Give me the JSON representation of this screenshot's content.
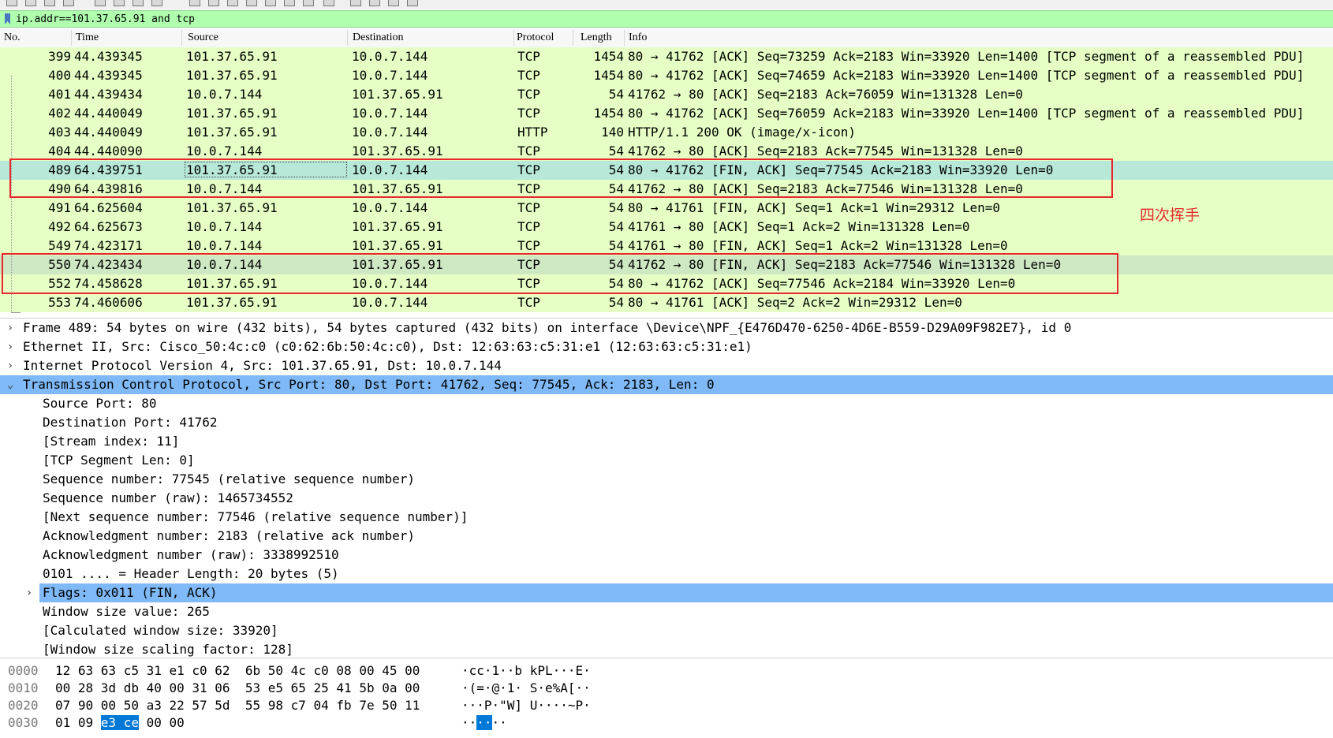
{
  "filter": {
    "value": "ip.addr==101.37.65.91 and tcp"
  },
  "columns": {
    "no": "No.",
    "time": "Time",
    "source": "Source",
    "destination": "Destination",
    "protocol": "Protocol",
    "length": "Length",
    "info": "Info"
  },
  "packets": [
    {
      "no": "399",
      "time": "44.439345",
      "src": "101.37.65.91",
      "dst": "10.0.7.144",
      "proto": "TCP",
      "len": "1454",
      "info": "80 → 41762 [ACK] Seq=73259 Ack=2183 Win=33920 Len=1400 [TCP segment of a reassembled PDU]"
    },
    {
      "no": "400",
      "time": "44.439345",
      "src": "101.37.65.91",
      "dst": "10.0.7.144",
      "proto": "TCP",
      "len": "1454",
      "info": "80 → 41762 [ACK] Seq=74659 Ack=2183 Win=33920 Len=1400 [TCP segment of a reassembled PDU]"
    },
    {
      "no": "401",
      "time": "44.439434",
      "src": "10.0.7.144",
      "dst": "101.37.65.91",
      "proto": "TCP",
      "len": "54",
      "info": "41762 → 80 [ACK] Seq=2183 Ack=76059 Win=131328 Len=0"
    },
    {
      "no": "402",
      "time": "44.440049",
      "src": "101.37.65.91",
      "dst": "10.0.7.144",
      "proto": "TCP",
      "len": "1454",
      "info": "80 → 41762 [ACK] Seq=76059 Ack=2183 Win=33920 Len=1400 [TCP segment of a reassembled PDU]"
    },
    {
      "no": "403",
      "time": "44.440049",
      "src": "101.37.65.91",
      "dst": "10.0.7.144",
      "proto": "HTTP",
      "len": "140",
      "info": "HTTP/1.1 200 OK  (image/x-icon)"
    },
    {
      "no": "404",
      "time": "44.440090",
      "src": "10.0.7.144",
      "dst": "101.37.65.91",
      "proto": "TCP",
      "len": "54",
      "info": "41762 → 80 [ACK] Seq=2183 Ack=77545 Win=131328 Len=0"
    },
    {
      "no": "489",
      "time": "64.439751",
      "src": "101.37.65.91",
      "dst": "10.0.7.144",
      "proto": "TCP",
      "len": "54",
      "info": "80 → 41762 [FIN, ACK] Seq=77545 Ack=2183 Win=33920 Len=0"
    },
    {
      "no": "490",
      "time": "64.439816",
      "src": "10.0.7.144",
      "dst": "101.37.65.91",
      "proto": "TCP",
      "len": "54",
      "info": "41762 → 80 [ACK] Seq=2183 Ack=77546 Win=131328 Len=0"
    },
    {
      "no": "491",
      "time": "64.625604",
      "src": "101.37.65.91",
      "dst": "10.0.7.144",
      "proto": "TCP",
      "len": "54",
      "info": "80 → 41761 [FIN, ACK] Seq=1 Ack=1 Win=29312 Len=0"
    },
    {
      "no": "492",
      "time": "64.625673",
      "src": "10.0.7.144",
      "dst": "101.37.65.91",
      "proto": "TCP",
      "len": "54",
      "info": "41761 → 80 [ACK] Seq=1 Ack=2 Win=131328 Len=0"
    },
    {
      "no": "549",
      "time": "74.423171",
      "src": "10.0.7.144",
      "dst": "101.37.65.91",
      "proto": "TCP",
      "len": "54",
      "info": "41761 → 80 [FIN, ACK] Seq=1 Ack=2 Win=131328 Len=0"
    },
    {
      "no": "550",
      "time": "74.423434",
      "src": "10.0.7.144",
      "dst": "101.37.65.91",
      "proto": "TCP",
      "len": "54",
      "info": "41762 → 80 [FIN, ACK] Seq=2183 Ack=77546 Win=131328 Len=0"
    },
    {
      "no": "552",
      "time": "74.458628",
      "src": "101.37.65.91",
      "dst": "10.0.7.144",
      "proto": "TCP",
      "len": "54",
      "info": "80 → 41762 [ACK] Seq=77546 Ack=2184 Win=33920 Len=0"
    },
    {
      "no": "553",
      "time": "74.460606",
      "src": "101.37.65.91",
      "dst": "10.0.7.144",
      "proto": "TCP",
      "len": "54",
      "info": "80 → 41761 [ACK] Seq=2 Ack=2 Win=29312 Len=0"
    }
  ],
  "annotation": {
    "text": "四次挥手"
  },
  "details": [
    "Frame 489: 54 bytes on wire (432 bits), 54 bytes captured (432 bits) on interface \\Device\\NPF_{E476D470-6250-4D6E-B559-D29A09F982E7}, id 0",
    "Ethernet II, Src: Cisco_50:4c:c0 (c0:62:6b:50:4c:c0), Dst: 12:63:63:c5:31:e1 (12:63:63:c5:31:e1)",
    "Internet Protocol Version 4, Src: 101.37.65.91, Dst: 10.0.7.144",
    "Transmission Control Protocol, Src Port: 80, Dst Port: 41762, Seq: 77545, Ack: 2183, Len: 0",
    "Source Port: 80",
    "Destination Port: 41762",
    "[Stream index: 11]",
    "[TCP Segment Len: 0]",
    "Sequence number: 77545    (relative sequence number)",
    "Sequence number (raw): 1465734552",
    "[Next sequence number: 77546    (relative sequence number)]",
    "Acknowledgment number: 2183    (relative ack number)",
    "Acknowledgment number (raw): 3338992510",
    "0101 .... = Header Length: 20 bytes (5)",
    "Flags: 0x011 (FIN, ACK)",
    "Window size value: 265",
    "[Calculated window size: 33920]",
    "[Window size scaling factor: 128]"
  ],
  "bytes": [
    {
      "offset": "0000",
      "hex": "12 63 63 c5 31 e1 c0 62  6b 50 4c c0 08 00 45 00",
      "ascii": "·cc·1··b kPL···E·"
    },
    {
      "offset": "0010",
      "hex": "00 28 3d db 40 00 31 06  53 e5 65 25 41 5b 0a 00",
      "ascii": "·(=·@·1· S·e%A[··"
    },
    {
      "offset": "0020",
      "hex": "07 90 00 50 a3 22 57 5d  55 98 c7 04 fb 7e 50 11",
      "ascii": "···P·\"W] U····~P·"
    },
    {
      "offset": "0030",
      "hex_pre": "01 09 ",
      "hex_sel": "e3 ce",
      "hex_post": " 00 00",
      "ascii_pre": "··",
      "ascii_sel": "··",
      "ascii_post": "··"
    }
  ]
}
